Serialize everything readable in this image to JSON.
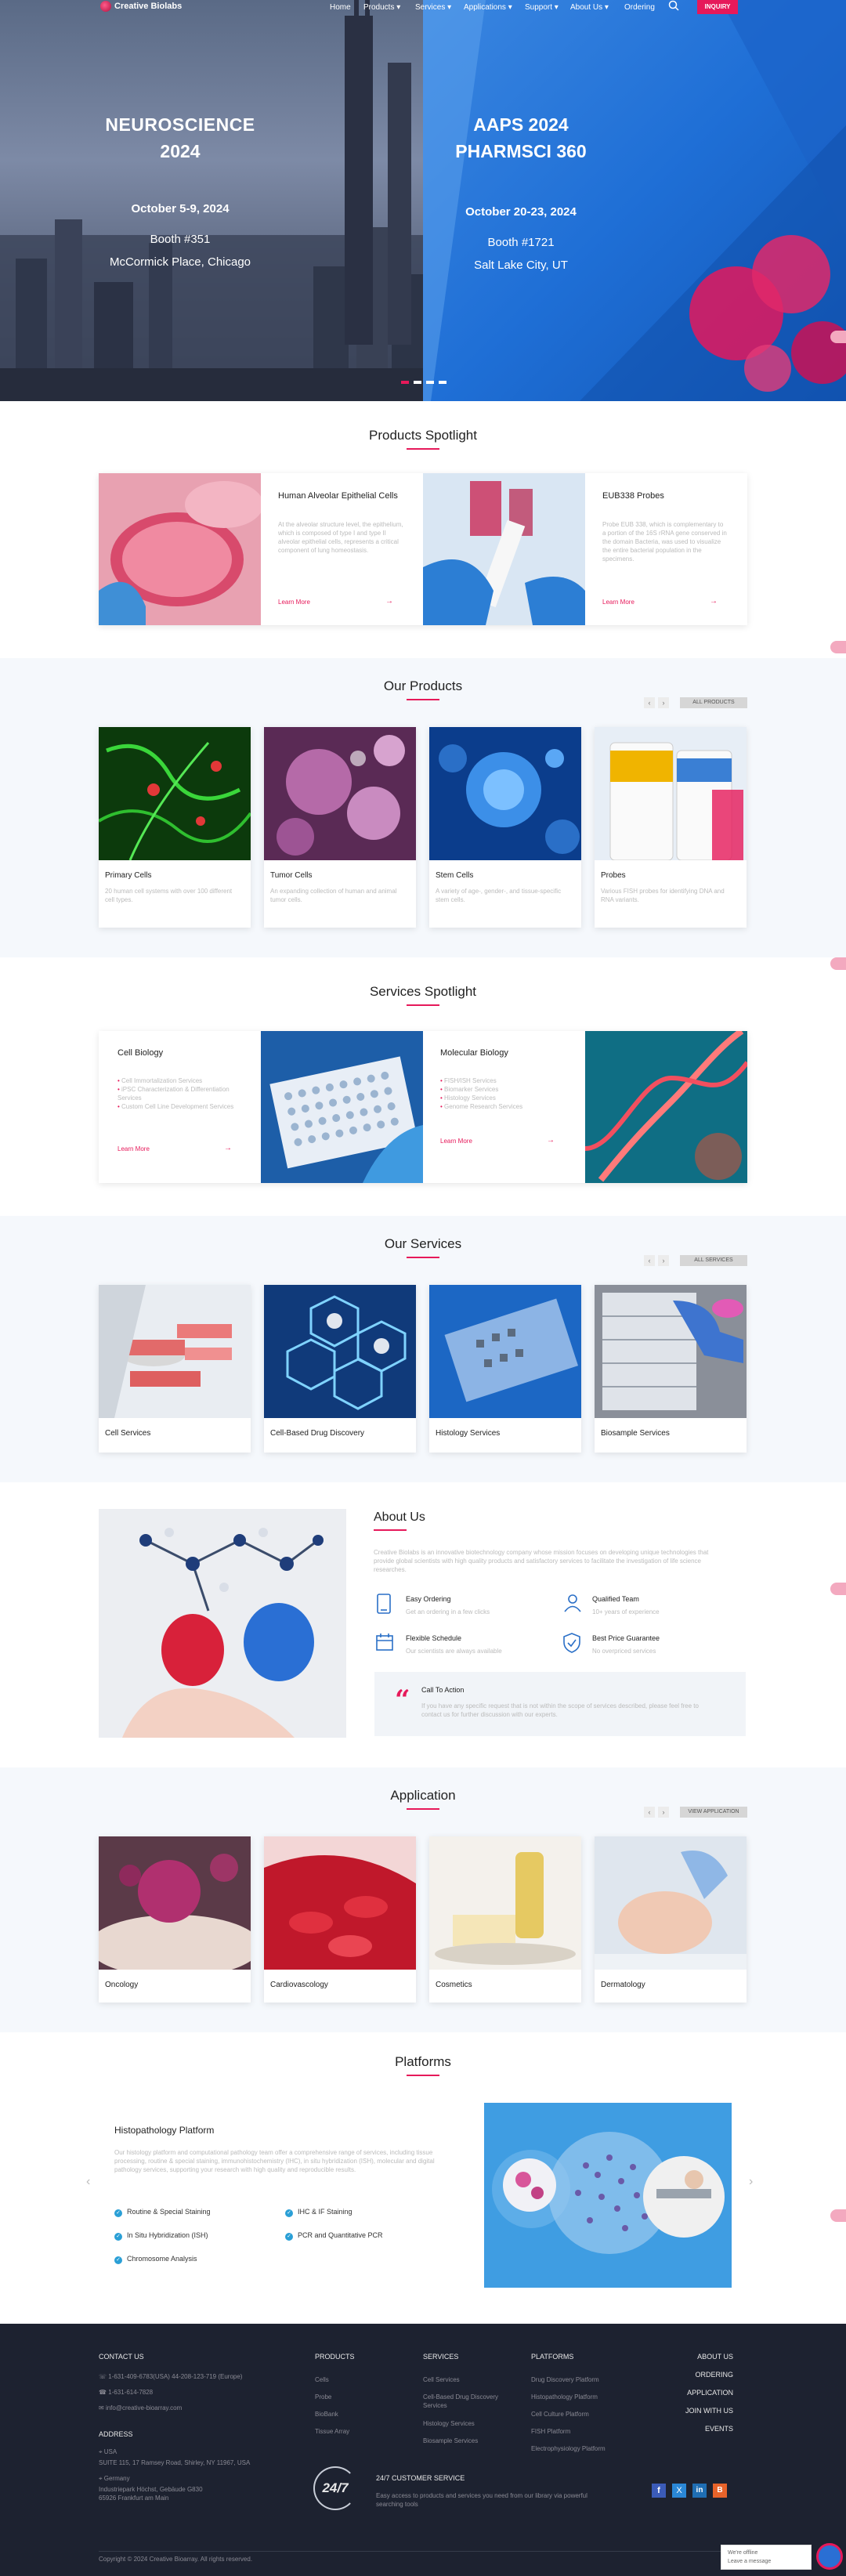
{
  "nav": {
    "brand": "Creative Biolabs",
    "items": [
      "Home",
      "Products",
      "Services",
      "Applications",
      "Support",
      "About Us",
      "Ordering"
    ],
    "inquiry": "INQUIRY"
  },
  "hero": {
    "left": {
      "title1": "NEUROSCIENCE",
      "title2": "2024",
      "date": "October 5-9, 2024",
      "booth": "Booth #351",
      "place": "McCormick Place, Chicago"
    },
    "right": {
      "title1": "AAPS 2024",
      "title2": "PHARMSCI 360",
      "date": "October 20-23, 2024",
      "booth": "Booth #1721",
      "place": "Salt Lake City, UT"
    }
  },
  "products_spotlight": {
    "title": "Products Spotlight",
    "cards": [
      {
        "title": "Human Alveolar Epithelial Cells",
        "desc": "At the alveolar structure level, the epithelium, which is composed of type I and type II alveolar epithelial cells, represents a critical component of lung homeostasis.",
        "link": "Learn More"
      },
      {
        "title": "EUB338 Probes",
        "desc": "Probe EUB 338, which is complementary to a portion of the 16S rRNA gene conserved in the domain Bacteria, was used to visualize the entire bacterial population in the specimens.",
        "link": "Learn More"
      }
    ]
  },
  "our_products": {
    "title": "Our Products",
    "all": "ALL PRODUCTS",
    "items": [
      {
        "name": "Primary Cells",
        "desc": "20 human cell systems with over 100 different cell types."
      },
      {
        "name": "Tumor Cells",
        "desc": "An expanding collection of human and animal tumor cells."
      },
      {
        "name": "Stem Cells",
        "desc": "A variety of age-, gender-, and tissue-specific stem cells."
      },
      {
        "name": "Probes",
        "desc": "Various FISH probes for identifying DNA and RNA variants."
      }
    ]
  },
  "services_spotlight": {
    "title": "Services Spotlight",
    "cards": [
      {
        "title": "Cell Biology",
        "bullets": [
          "Cell Immortalization Services",
          "iPSC Characterization & Differentiation Services",
          "Custom Cell Line Development Services"
        ],
        "link": "Learn More"
      },
      {
        "title": "Molecular Biology",
        "bullets": [
          "FISH/ISH Services",
          "Biomarker Services",
          "Histology Services",
          "Genome Research Services"
        ],
        "link": "Learn More"
      }
    ]
  },
  "our_services": {
    "title": "Our Services",
    "all": "ALL SERVICES",
    "items": [
      "Cell Services",
      "Cell-Based Drug Discovery",
      "Histology Services",
      "Biosample Services"
    ]
  },
  "about": {
    "title": "About Us",
    "desc": "Creative Biolabs is an innovative biotechnology company whose mission focuses on developing unique technologies that provide global scientists with high quality products and satisfactory services to facilitate the investigation of life science researches.",
    "features": [
      {
        "icon": "tablet-icon",
        "title": "Easy Ordering",
        "desc": "Get an ordering in a few clicks"
      },
      {
        "icon": "team-icon",
        "title": "Qualified Team",
        "desc": "10+ years of experience"
      },
      {
        "icon": "calendar-icon",
        "title": "Flexible Schedule",
        "desc": "Our scientists are always available"
      },
      {
        "icon": "shield-icon",
        "title": "Best Price Guarantee",
        "desc": "No overpriced services"
      }
    ],
    "callout": {
      "title": "Call To Action",
      "desc": "If you have any specific request that is not within the scope of services described, please feel free to contact us for further discussion with our experts."
    }
  },
  "application": {
    "title": "Application",
    "all": "VIEW APPLICATION",
    "items": [
      "Oncology",
      "Cardiovascology",
      "Cosmetics",
      "Dermatology"
    ]
  },
  "platforms": {
    "title": "Platforms",
    "heading": "Histopathology Platform",
    "desc": "Our histology platform and computational pathology team offer a comprehensive range of services, including tissue processing, routine & special staining, immunohistochemistry (IHC), in situ hybridization (ISH), molecular and digital pathology services, supporting your research with high quality and reproducible results.",
    "checks": [
      "Routine & Special Staining",
      "IHC & IF Staining",
      "In Situ Hybridization (ISH)",
      "PCR and Quantitative PCR",
      "Chromosome Analysis"
    ]
  },
  "footer": {
    "contact_title": "CONTACT US",
    "phones": "1-631-409-6783(USA)   44-208-123-719 (Europe)",
    "fax": "1-631-614-7828",
    "email": "info@creative-bioarray.com",
    "address_title": "ADDRESS",
    "usa_label": "USA",
    "usa_addr": "SUITE 115, 17 Ramsey Road, Shirley, NY 11967, USA",
    "germany_label": "Germany",
    "germany_addr": "Industriepark Höchst, Gebäude G830 65926 Frankfurt am Main",
    "products_title": "PRODUCTS",
    "products": [
      "Cells",
      "Probe",
      "BioBank",
      "Tissue Array"
    ],
    "services_title": "SERVICES",
    "services": [
      "Cell Services",
      "Cell-Based Drug Discovery Services",
      "Histology Services",
      "Biosample Services"
    ],
    "platforms_title": "PLATFORMS",
    "platforms": [
      "Drug Discovery Platform",
      "Histopathology Platform",
      "Cell Culture Platform",
      "FISH Platform",
      "Electrophysiology Platform"
    ],
    "right_links": [
      "ABOUT US",
      "ORDERING",
      "APPLICATION",
      "JOIN WITH US",
      "EVENTS"
    ],
    "support_badge": "24/7",
    "support_title": "24/7 CUSTOMER SERVICE",
    "support_desc": "Easy access to products and services you need from our library via powerful searching tools",
    "copyright": "Copyright © 2024 Creative Bioarray. All rights reserved.",
    "chat_line1": "We're offline",
    "chat_line2": "Leave a message"
  },
  "colors": {
    "accent": "#e6195a",
    "footer_bg": "#1d2230",
    "section_alt_bg": "#f5f8fc"
  }
}
